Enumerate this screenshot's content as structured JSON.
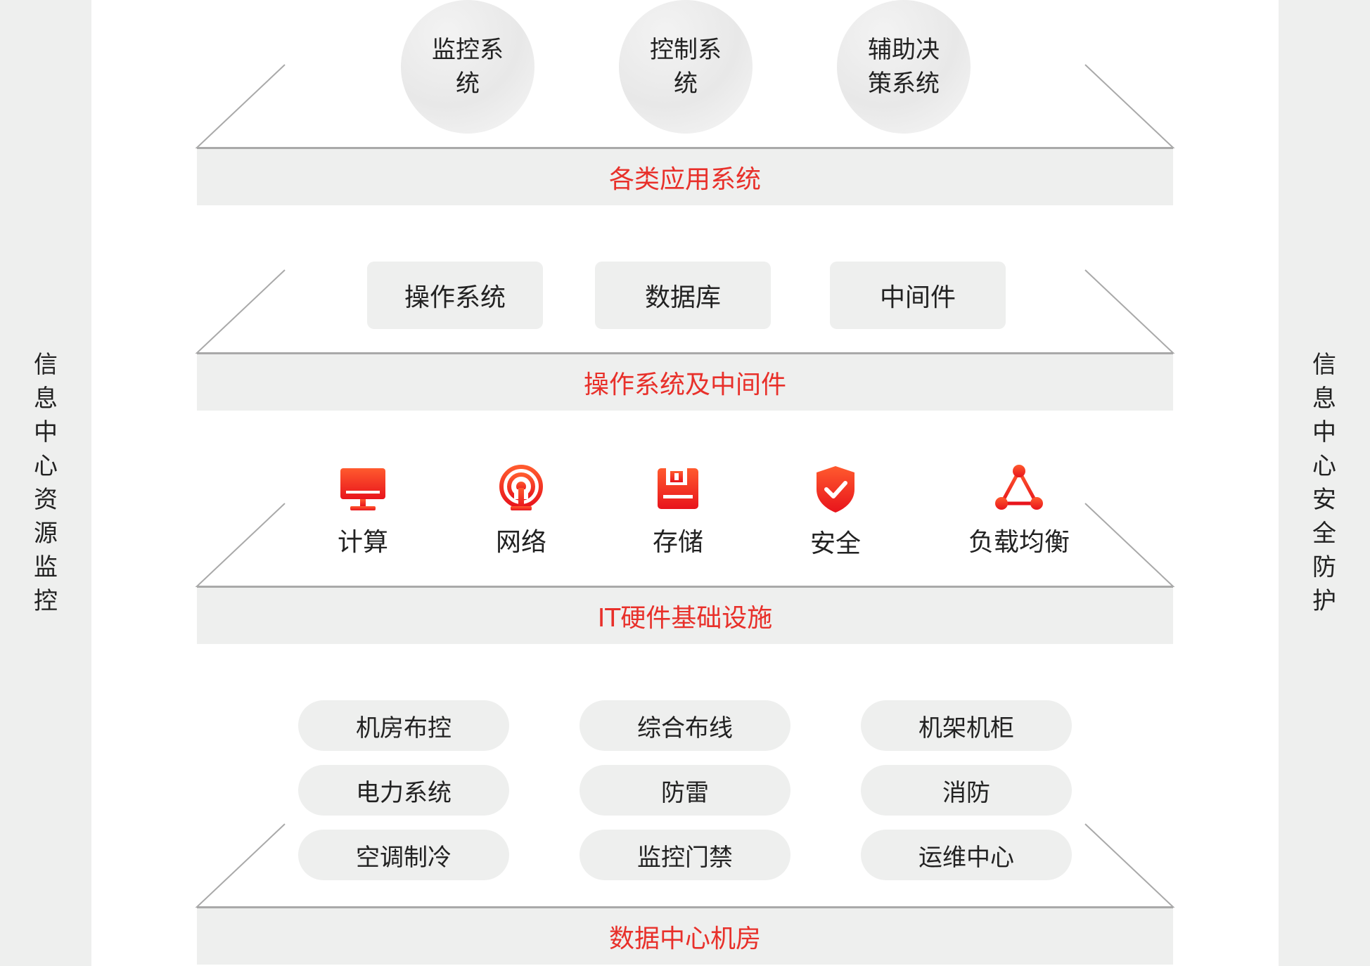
{
  "left_side_label": "信息中心资源监控",
  "right_side_label": "信息中心安全防护",
  "tiers": {
    "applications": {
      "band_label": "各类应用系统",
      "items": [
        "监控系统",
        "控制系统",
        "辅助决策系统"
      ]
    },
    "os_middleware": {
      "band_label": "操作系统及中间件",
      "items": [
        "操作系统",
        "数据库",
        "中间件"
      ]
    },
    "it_hardware": {
      "band_label": "IT硬件基础设施",
      "items": [
        {
          "label": "计算",
          "icon": "monitor-icon"
        },
        {
          "label": "网络",
          "icon": "antenna-icon"
        },
        {
          "label": "存储",
          "icon": "floppy-disk-icon"
        },
        {
          "label": "安全",
          "icon": "shield-check-icon"
        },
        {
          "label": "负载均衡",
          "icon": "network-triangle-icon"
        }
      ]
    },
    "datacenter": {
      "band_label": "数据中心机房",
      "items": [
        "机房布控",
        "综合布线",
        "机架机柜",
        "电力系统",
        "防雷",
        "消防",
        "空调制冷",
        "监控门禁",
        "运维中心"
      ]
    }
  },
  "colors": {
    "accent": "#e8302a",
    "icon_gradient_top": "#ff5a2e",
    "icon_gradient_bottom": "#e8141c",
    "panel_gray": "#eeefee",
    "side_gray": "#eeefee"
  }
}
